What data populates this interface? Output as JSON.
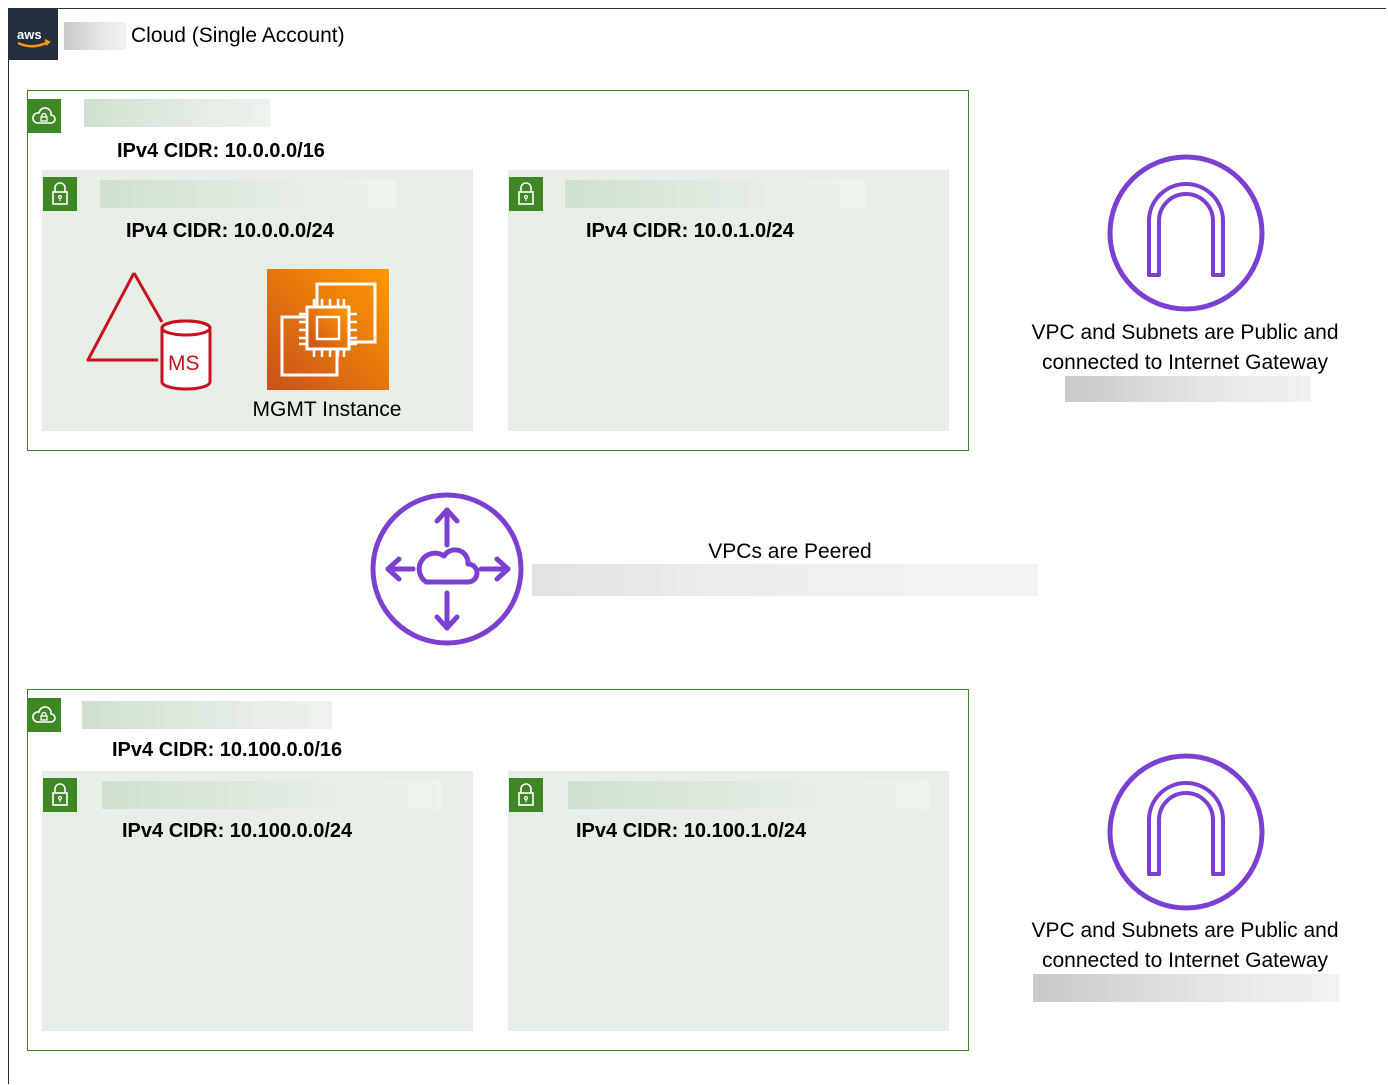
{
  "diagram": {
    "account": {
      "title": "Cloud (Single Account)"
    },
    "vpcs": [
      {
        "cidr": "IPv4 CIDR: 10.0.0.0/16",
        "subnets": [
          {
            "cidr": "IPv4 CIDR: 10.0.0.0/24",
            "instance_label": "MGMT Instance"
          },
          {
            "cidr": "IPv4 CIDR: 10.0.1.0/24"
          }
        ],
        "gateway_note": [
          "VPC and Subnets are Public and",
          "connected to Internet Gateway"
        ]
      },
      {
        "cidr": "IPv4 CIDR: 10.100.0.0/16",
        "subnets": [
          {
            "cidr": "IPv4 CIDR: 10.100.0.0/24"
          },
          {
            "cidr": "IPv4 CIDR: 10.100.1.0/24"
          }
        ],
        "gateway_note": [
          "VPC and Subnets are Public and",
          "connected to Internet Gateway"
        ]
      }
    ],
    "peering": {
      "label": "VPCs are Peered"
    },
    "colors": {
      "vpc_border": "#3f8624",
      "subnet_fill": "#e6eee5",
      "gateway_purple": "#7b3fd2",
      "rds_red": "#c7131f",
      "ec2_orange": "#e56c12",
      "aws_dark": "#232f3e"
    },
    "icons": [
      "aws-logo-icon",
      "vpc-cloud-lock-icon",
      "subnet-lock-icon",
      "rds-sqlserver-icon",
      "ec2-instance-icon",
      "internet-gateway-icon",
      "peering-router-icon"
    ]
  }
}
